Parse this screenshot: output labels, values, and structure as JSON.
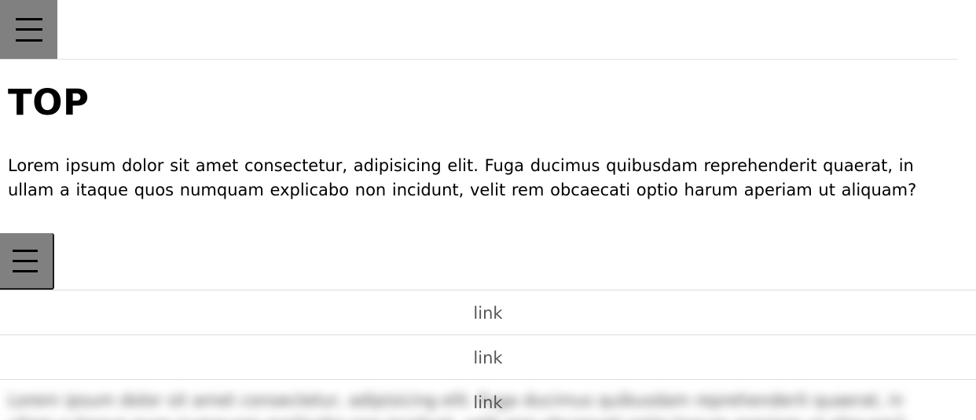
{
  "header": {
    "menu_icon": "hamburger-icon",
    "title": "TOP"
  },
  "main": {
    "paragraph": "Lorem ipsum dolor sit amet consectetur, adipisicing elit. Fuga ducimus quibusdam reprehenderit quaerat, in ullam a itaque quos numquam explicabo non incidunt, velit rem obcaecati optio harum aperiam ut aliquam?"
  },
  "nav": {
    "menu_icon": "hamburger-icon",
    "links": [
      {
        "label": "link"
      },
      {
        "label": "link"
      },
      {
        "label": "link"
      }
    ]
  },
  "colors": {
    "menu_button_bg": "#808080",
    "link_text": "#555555",
    "divider": "#dcdcdc"
  }
}
